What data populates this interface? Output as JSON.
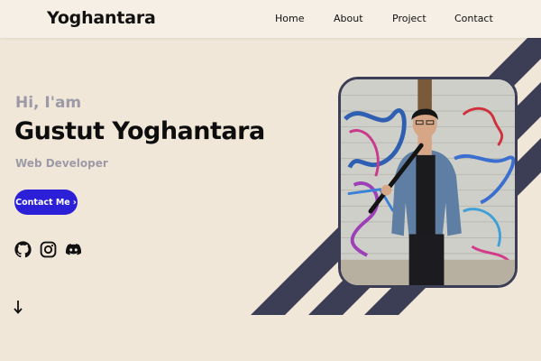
{
  "brand": {
    "name": "Yoghantara"
  },
  "nav": [
    {
      "label": "Home"
    },
    {
      "label": "About"
    },
    {
      "label": "Project"
    },
    {
      "label": "Contact"
    }
  ],
  "hero": {
    "greeting": "Hi, I'am",
    "name": "Gustut Yoghantara",
    "role": "Web Developer",
    "cta_label": "Contact Me",
    "cta_icon": "chevron-right-icon"
  },
  "socials": [
    {
      "icon": "github-icon"
    },
    {
      "icon": "instagram-icon"
    },
    {
      "icon": "discord-icon"
    }
  ],
  "scroll": {
    "icon": "arrow-down-icon"
  },
  "photo": {
    "subject": "portrait-photo"
  },
  "colors": {
    "background": "#f1e7d9",
    "navbar": "#f5efe6",
    "accent": "#2b1fd8",
    "muted_text": "#9c9aa6",
    "stripes": "#3b3e55"
  }
}
